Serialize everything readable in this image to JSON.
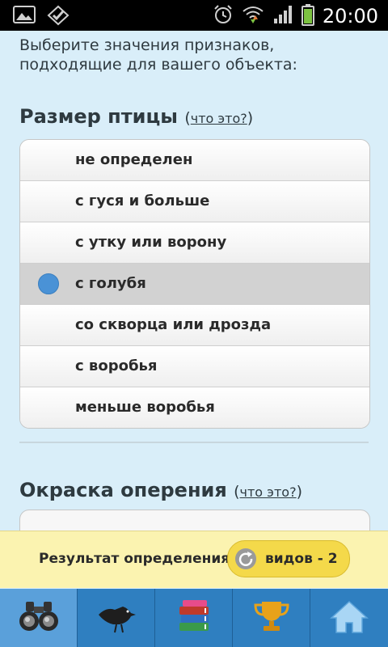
{
  "status_bar": {
    "time": "20:00",
    "icons": [
      "gallery-icon",
      "check-icon",
      "alarm-icon",
      "wifi-icon",
      "signal-icon",
      "battery-icon"
    ]
  },
  "intro": "Выберите значения признаков, подходящие для вашего объекта:",
  "sections": [
    {
      "title": "Размер птицы",
      "link": "что это?",
      "options": [
        {
          "label": "не определен",
          "selected": false
        },
        {
          "label": "с гуся и больше",
          "selected": false
        },
        {
          "label": "с утку или ворону",
          "selected": false
        },
        {
          "label": "с голубя",
          "selected": true
        },
        {
          "label": "со скворца или дрозда",
          "selected": false
        },
        {
          "label": "с воробья",
          "selected": false
        },
        {
          "label": "меньше воробья",
          "selected": false
        }
      ]
    },
    {
      "title": "Окраска оперения",
      "link": "что это?"
    }
  ],
  "result": {
    "label": "Результат определения:",
    "pill": "видов - 2"
  },
  "tabs": [
    {
      "icon": "binoculars-icon",
      "active": true
    },
    {
      "icon": "bird-icon",
      "active": false
    },
    {
      "icon": "books-icon",
      "active": false
    },
    {
      "icon": "trophy-icon",
      "active": false
    },
    {
      "icon": "home-icon",
      "active": false
    }
  ],
  "colors": {
    "background": "#d9eef9",
    "selected_radio": "#4a92d6",
    "result_bar": "#fbf3b0",
    "result_pill": "#f4d94a",
    "tab_bar": "#2f7fc0"
  }
}
